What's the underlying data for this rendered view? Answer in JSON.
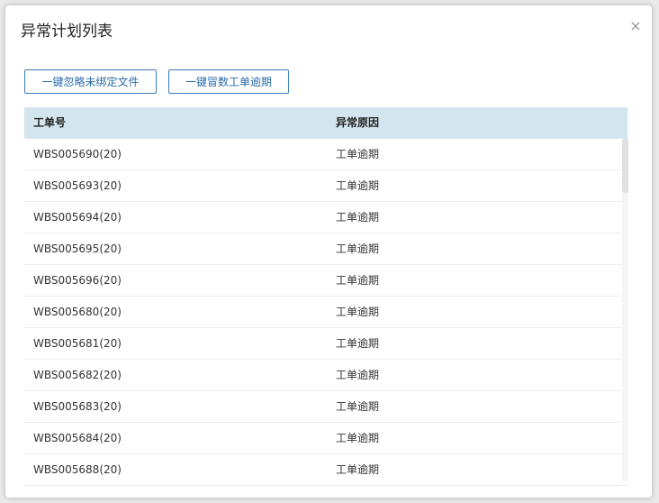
{
  "dialog": {
    "title": "异常计划列表",
    "close_icon": "×"
  },
  "toolbar": {
    "ignore_unbound_label": "一键忽略未绑定文件",
    "batch_overdue_label": "一键冒数工单逾期"
  },
  "table": {
    "columns": [
      "工单号",
      "异常原因"
    ],
    "rows": [
      {
        "order": "WBS005690(20)",
        "reason": "工单逾期"
      },
      {
        "order": "WBS005693(20)",
        "reason": "工单逾期"
      },
      {
        "order": "WBS005694(20)",
        "reason": "工单逾期"
      },
      {
        "order": "WBS005695(20)",
        "reason": "工单逾期"
      },
      {
        "order": "WBS005696(20)",
        "reason": "工单逾期"
      },
      {
        "order": "WBS005680(20)",
        "reason": "工单逾期"
      },
      {
        "order": "WBS005681(20)",
        "reason": "工单逾期"
      },
      {
        "order": "WBS005682(20)",
        "reason": "工单逾期"
      },
      {
        "order": "WBS005683(20)",
        "reason": "工单逾期"
      },
      {
        "order": "WBS005684(20)",
        "reason": "工单逾期"
      },
      {
        "order": "WBS005688(20)",
        "reason": "工单逾期"
      }
    ]
  }
}
